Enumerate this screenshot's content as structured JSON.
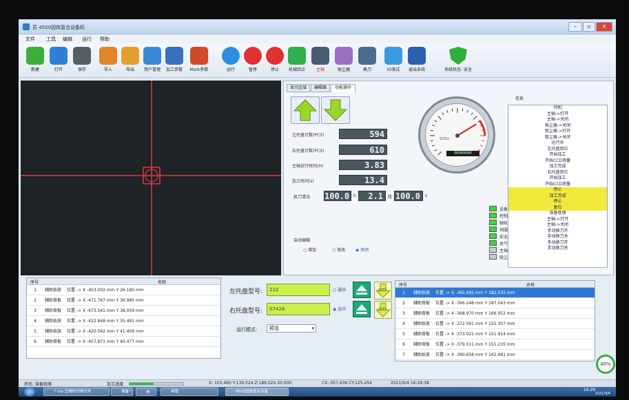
{
  "window": {
    "title": "员 4500固体复合设备机"
  },
  "menu": [
    "文件",
    "工具",
    "编辑",
    "运行",
    "帮助"
  ],
  "toolbar": [
    {
      "label": "新建",
      "icon": "new-file-icon",
      "color": "#3cae3c"
    },
    {
      "label": "打开",
      "icon": "open-folder-icon",
      "color": "#2f7fd8"
    },
    {
      "label": "保存",
      "icon": "save-disk-icon",
      "color": "#555d66"
    },
    {
      "label": "导入",
      "icon": "import-icon",
      "color": "#e0862a"
    },
    {
      "label": "导出",
      "icon": "export-icon",
      "color": "#e0a02a"
    },
    {
      "label": "用户管理",
      "icon": "users-icon",
      "color": "#3a88d8"
    },
    {
      "label": "加工参数",
      "icon": "process-params-icon",
      "color": "#3a6fc0"
    },
    {
      "label": "Mark参数",
      "icon": "mark-params-icon",
      "color": "#d04a2a"
    },
    {
      "label": "运行",
      "icon": "play-icon",
      "color": "#2f8ce0"
    },
    {
      "label": "暂停",
      "icon": "pause-icon",
      "color": "#e03030"
    },
    {
      "label": "停止",
      "icon": "stop-icon",
      "color": "#e03030"
    },
    {
      "label": "机械回点",
      "icon": "home-refresh-icon",
      "color": "#2fb04a"
    },
    {
      "label": "主轴",
      "icon": "spindle-icon",
      "color": "#4a5a70"
    },
    {
      "label": "吸尘器",
      "icon": "vacuum-icon",
      "color": "#9a6fc0"
    },
    {
      "label": "换刀",
      "icon": "tool-change-icon",
      "color": "#4a6a90"
    },
    {
      "label": "IO测试",
      "icon": "bulb-icon",
      "color": "#3a9ae0"
    },
    {
      "label": "退出系统",
      "icon": "exit-icon",
      "color": "#2a5fb0"
    },
    {
      "label": "系统状态: 安全",
      "icon": "shield-check-icon",
      "color": "#2fae3a"
    }
  ],
  "tabs": [
    "显示区域",
    "编辑面",
    "功能操作"
  ],
  "counters": [
    {
      "label": "左托盘计数(PCS)",
      "value": "594"
    },
    {
      "label": "右托盘计数(PCS)",
      "value": "610"
    },
    {
      "label": "主轴运行时间(H)",
      "value": "3.83"
    },
    {
      "label": "加工时间(s)",
      "value": "13.4"
    }
  ],
  "interval": {
    "label": "执刀清洁",
    "v1": "100.0",
    "u1": "h",
    "v2": "2.1",
    "u2": "段",
    "v3": "100.0",
    "u3": "s"
  },
  "mode": {
    "label": "自动编辑",
    "options": [
      "增加",
      "修改",
      "关闭"
    ],
    "selected": 2
  },
  "gauge": {
    "display": "0000000",
    "brand": "SDSU"
  },
  "status_indicators": [
    {
      "label": "设备",
      "color": "#42d442"
    },
    {
      "label": "控制器",
      "color": "#42d442"
    },
    {
      "label": "轴机",
      "color": "#42d442"
    },
    {
      "label": "伺服器",
      "color": "#42d442"
    },
    {
      "label": "安全门",
      "color": "#42d442"
    },
    {
      "label": "总气压",
      "color": "#42d442"
    },
    {
      "label": "主轴",
      "color": "#c7ced6"
    },
    {
      "label": "吸尘器",
      "color": "#c7ced6"
    }
  ],
  "info": {
    "title": "信息",
    "messages": [
      "待机",
      "主轴->打开",
      "主轴->关闭",
      "吸尘器->关闭",
      "吸尘器->打开",
      "吸尘器->关闭",
      "运行中",
      "左托盘到位",
      "开始加工",
      "开始CCD测量",
      "加工完成",
      "右托盘到位",
      "开始加工",
      "开始CCD测量",
      "停止",
      "加工完成",
      "停止",
      "复位",
      "准备就绪",
      "主轴->打开",
      "主轴->关闭",
      "手动换刀开",
      "手动换刀关",
      "手动换刀开",
      "手动换刀关"
    ],
    "highlighted": [
      14,
      15,
      16,
      17
    ]
  },
  "left_table": {
    "h_no": "序号",
    "h_name": "名称",
    "rows": [
      {
        "no": "1",
        "name": "辅助抬放",
        "pos": "位置 -> X -403.002 mm  Y 26.180 mm"
      },
      {
        "no": "2",
        "name": "辅助背板",
        "pos": "位置 -> X -471.767 mm  Y 36.985 mm"
      },
      {
        "no": "3",
        "name": "辅助背板",
        "pos": "位置 -> X -473.541 mm  Y 38.059 mm"
      },
      {
        "no": "4",
        "name": "辅助抬放",
        "pos": "位置 -> X -422.848 mm  Y 35.491 mm"
      },
      {
        "no": "5",
        "name": "辅助抬放",
        "pos": "位置 -> X -420.042 mm  Y 41.409 mm"
      },
      {
        "no": "6",
        "name": "辅助背板",
        "pos": "位置 -> X -457.871 mm  Y 40.477 mm"
      }
    ]
  },
  "dialog": {
    "left_label": "左托盘型号:",
    "left_value": "222",
    "right_label": "右托盘型号:",
    "right_value": "07428",
    "check_left": "选中",
    "check_right": "选中",
    "mode_label": "运行模式:",
    "mode_value": "预览",
    "btn": "CCD"
  },
  "right_table": {
    "h_no": "序号",
    "h_name": "名称",
    "rows": [
      {
        "no": "1",
        "name": "辅助抬放",
        "pos": "位置 -> X -365.092 mm  Y 182.532 mm"
      },
      {
        "no": "2",
        "name": "辅助背板",
        "pos": "位置 -> X -366.248 mm  Y 187.043 mm"
      },
      {
        "no": "3",
        "name": "辅助背板",
        "pos": "位置 -> X -368.970 mm  Y 166.952 mm"
      },
      {
        "no": "4",
        "name": "辅助抬放",
        "pos": "位置 -> X -372.561 mm  Y 155.307 mm"
      },
      {
        "no": "5",
        "name": "辅助背板",
        "pos": "位置 -> X -373.021 mm  Y 151.914 mm"
      },
      {
        "no": "6",
        "name": "辅助背板",
        "pos": "位置 -> X -379.011 mm  Y 151.235 mm"
      },
      {
        "no": "7",
        "name": "辅助抬放",
        "pos": "位置 -> X -390.658 mm  Y 162.481 mm"
      }
    ]
  },
  "statusbar": {
    "state": "状态: 准备就绪",
    "progress_label": "加工进度",
    "coords": "X: 103.460  Y:139.024  Z:189.024  20.000",
    "cx": "CX:-357.636  CY:125.454",
    "datetime": "2021/9/4 16:29:38",
    "percent": "40%",
    "progress": 0.45
  },
  "taskbar": {
    "items": [
      "7-Zip 压缩的归档文件",
      "准备一下",
      "e",
      "画图",
      "4500固体复合设备"
    ],
    "time": "16:29",
    "date": "2021/9/4"
  }
}
